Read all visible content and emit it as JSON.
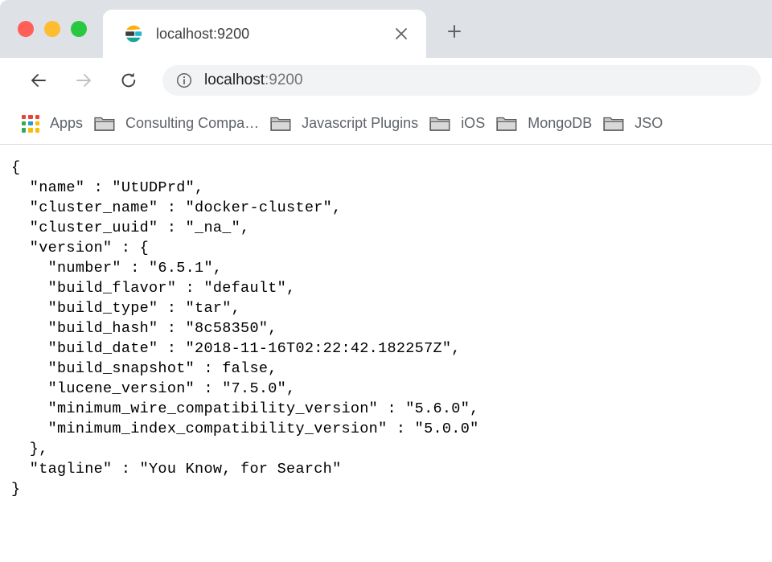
{
  "window": {
    "traffic_lights": [
      {
        "name": "close",
        "color": "#ff5f57"
      },
      {
        "name": "minimize",
        "color": "#febc2e"
      },
      {
        "name": "maximize",
        "color": "#28c840"
      }
    ]
  },
  "tab": {
    "title": "localhost:9200",
    "favicon": "elasticsearch-logo",
    "close_label": "×",
    "newtab_label": "+"
  },
  "toolbar": {
    "back_icon": "arrow-left",
    "forward_icon": "arrow-right",
    "reload_icon": "reload",
    "info_icon": "info-circle",
    "url_host": "localhost",
    "url_port": ":9200",
    "url_full": "localhost:9200"
  },
  "bookmarks": {
    "apps_label": "Apps",
    "apps_icon_colors": [
      "#ea4335",
      "#ea4335",
      "#ea4335",
      "#34a853",
      "#24a0c8",
      "#fbbc04",
      "#34a853",
      "#fbbc04",
      "#fbbc04"
    ],
    "items": [
      {
        "label": "Consulting Compa…",
        "icon": "folder-icon"
      },
      {
        "label": "Javascript Plugins",
        "icon": "folder-icon"
      },
      {
        "label": "iOS",
        "icon": "folder-icon"
      },
      {
        "label": "MongoDB",
        "icon": "folder-icon"
      },
      {
        "label": "JSO",
        "icon": "folder-icon"
      }
    ]
  },
  "page": {
    "content_type": "json",
    "body": "{\n  \"name\" : \"UtUDPrd\",\n  \"cluster_name\" : \"docker-cluster\",\n  \"cluster_uuid\" : \"_na_\",\n  \"version\" : {\n    \"number\" : \"6.5.1\",\n    \"build_flavor\" : \"default\",\n    \"build_type\" : \"tar\",\n    \"build_hash\" : \"8c58350\",\n    \"build_date\" : \"2018-11-16T02:22:42.182257Z\",\n    \"build_snapshot\" : false,\n    \"lucene_version\" : \"7.5.0\",\n    \"minimum_wire_compatibility_version\" : \"5.6.0\",\n    \"minimum_index_compatibility_version\" : \"5.0.0\"\n  },\n  \"tagline\" : \"You Know, for Search\"\n}",
    "values": {
      "name": "UtUDPrd",
      "cluster_name": "docker-cluster",
      "cluster_uuid": "_na_",
      "version_number": "6.5.1",
      "build_flavor": "default",
      "build_type": "tar",
      "build_hash": "8c58350",
      "build_date": "2018-11-16T02:22:42.182257Z",
      "build_snapshot": "false",
      "lucene_version": "7.5.0",
      "minimum_wire_compatibility_version": "5.6.0",
      "minimum_index_compatibility_version": "5.0.0",
      "tagline": "You Know, for Search"
    }
  }
}
